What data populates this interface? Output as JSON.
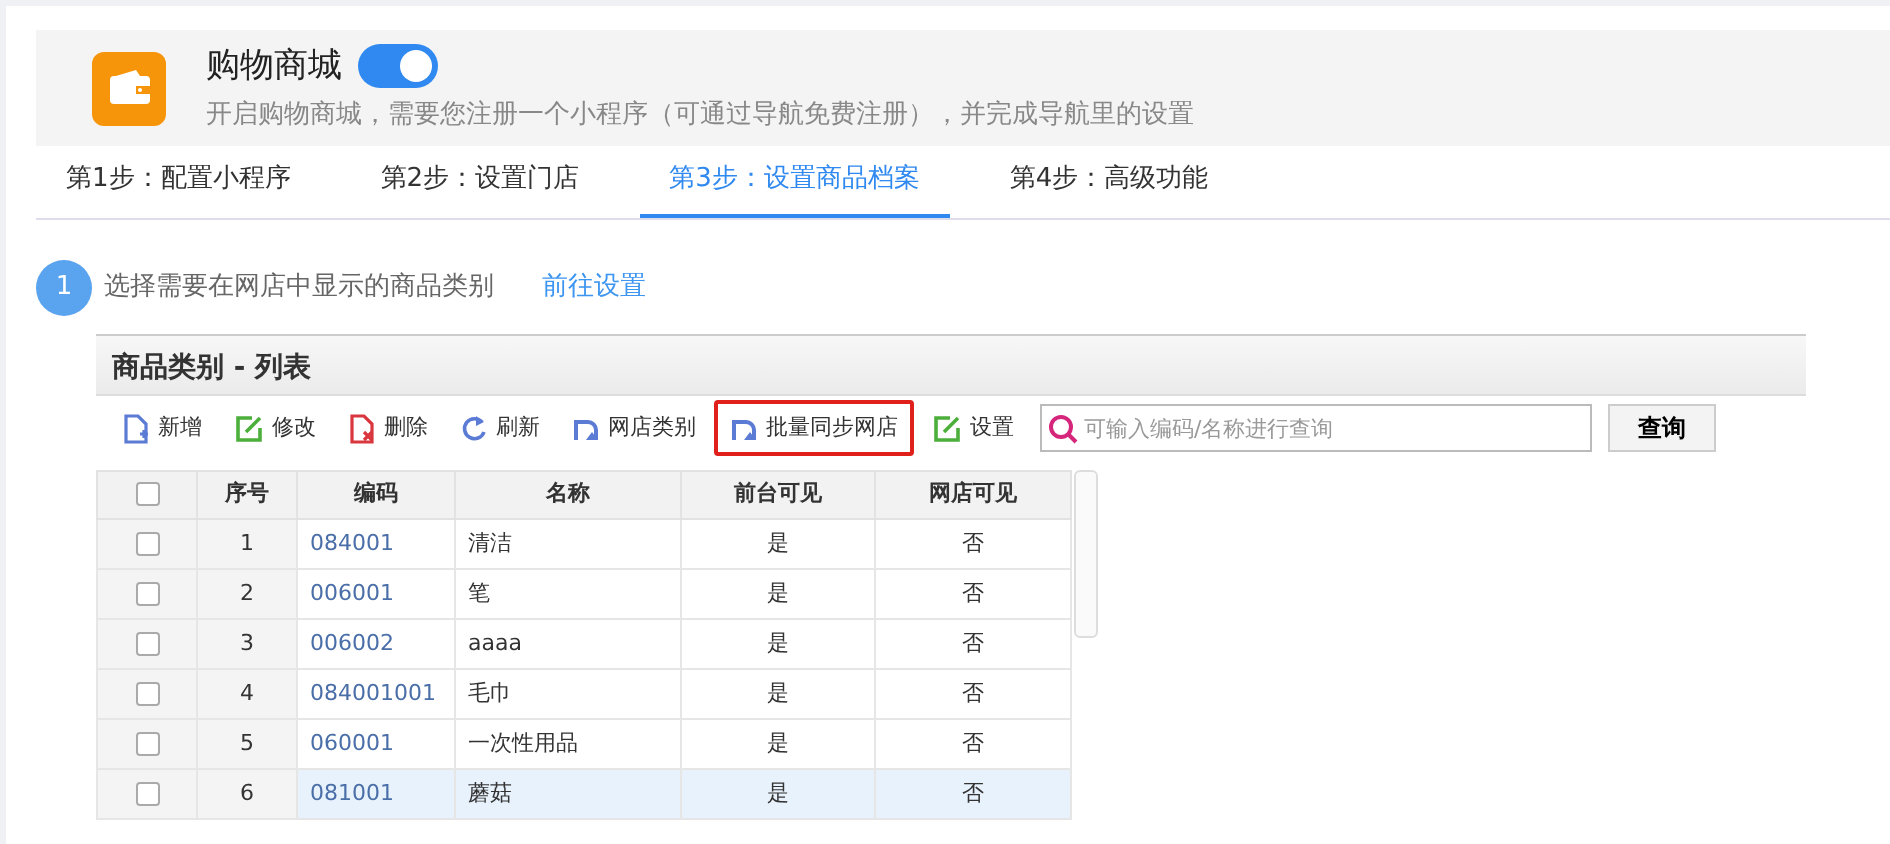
{
  "app": {
    "title": "购物商城",
    "enabled": true,
    "description": "开启购物商城，需要您注册一个小程序（可通过导航免费注册），并完成导航里的设置"
  },
  "tabs": [
    {
      "label": "第1步：配置小程序",
      "selected": false
    },
    {
      "label": "第2步：设置门店",
      "selected": false
    },
    {
      "label": "第3步：设置商品档案",
      "selected": true
    },
    {
      "label": "第4步：高级功能",
      "selected": false
    }
  ],
  "step": {
    "number": "1",
    "text": "选择需要在网店中显示的商品类别",
    "link": "前往设置"
  },
  "panel": {
    "title": "商品类别 - 列表",
    "toolbar": [
      {
        "kind": "add",
        "label": "新增",
        "highlighted": false
      },
      {
        "kind": "edit",
        "label": "修改",
        "highlighted": false
      },
      {
        "kind": "delete",
        "label": "删除",
        "highlighted": false
      },
      {
        "kind": "refresh",
        "label": "刷新",
        "highlighted": false
      },
      {
        "kind": "sync",
        "label": "网店类别",
        "highlighted": false
      },
      {
        "kind": "sync",
        "label": "批量同步网店",
        "highlighted": true
      },
      {
        "kind": "edit",
        "label": "设置",
        "highlighted": false
      }
    ],
    "search": {
      "placeholder": "可输入编码/名称进行查询",
      "button": "查询"
    },
    "table": {
      "select_all": false,
      "columns": [
        "序号",
        "编码",
        "名称",
        "前台可见",
        "网店可见"
      ],
      "rows": [
        {
          "index": "1",
          "code": "084001",
          "name": "清洁",
          "front_visible": "是",
          "shop_visible": "否",
          "checked": false,
          "selected": false
        },
        {
          "index": "2",
          "code": "006001",
          "name": "笔",
          "front_visible": "是",
          "shop_visible": "否",
          "checked": false,
          "selected": false
        },
        {
          "index": "3",
          "code": "006002",
          "name": "aaaa",
          "front_visible": "是",
          "shop_visible": "否",
          "checked": false,
          "selected": false
        },
        {
          "index": "4",
          "code": "084001001",
          "name": "毛巾",
          "front_visible": "是",
          "shop_visible": "否",
          "checked": false,
          "selected": false
        },
        {
          "index": "5",
          "code": "060001",
          "name": "一次性用品",
          "front_visible": "是",
          "shop_visible": "否",
          "checked": false,
          "selected": false
        },
        {
          "index": "6",
          "code": "081001",
          "name": "蘑菇",
          "front_visible": "是",
          "shop_visible": "否",
          "checked": false,
          "selected": true
        }
      ]
    }
  }
}
